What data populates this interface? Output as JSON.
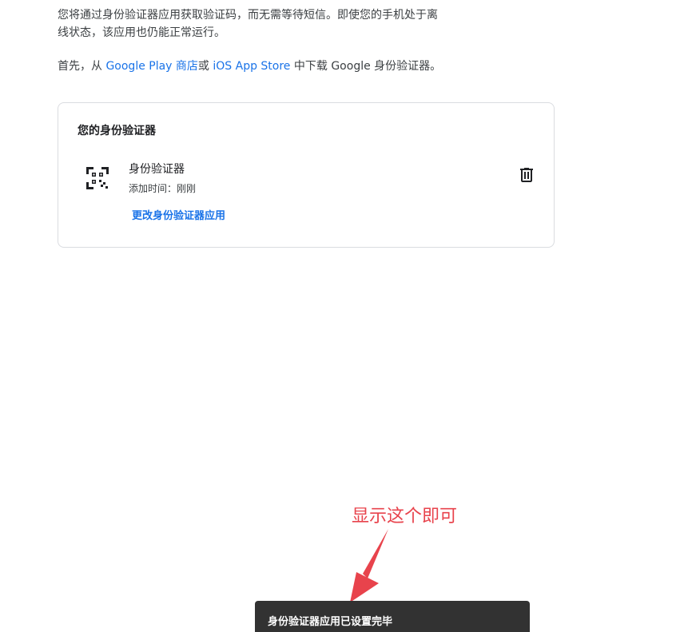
{
  "intro": {
    "line1": "您将通过身份验证器应用获取验证码，而无需等待短信。即使您的手机处于离",
    "line2": "线状态，该应用也仍能正常运行。"
  },
  "step": {
    "prefix": "首先，从 ",
    "google_play_link": "Google Play 商店",
    "or": "或 ",
    "app_store_link": "iOS App Store",
    "suffix": " 中下载 Google 身份验证器。"
  },
  "card": {
    "title": "您的身份验证器",
    "authenticator": {
      "name": "身份验证器",
      "added_time": "添加时间：刚刚",
      "icon": "qr-code-icon"
    },
    "change_link": "更改身份验证器应用",
    "delete_icon": "trash-icon"
  },
  "annotation": {
    "text": "显示这个即可",
    "color": "#e8434c"
  },
  "snackbar": {
    "text": "身份验证器应用已设置完毕"
  },
  "colors": {
    "link": "#1a73e8",
    "snackbar_bg": "#323232"
  }
}
